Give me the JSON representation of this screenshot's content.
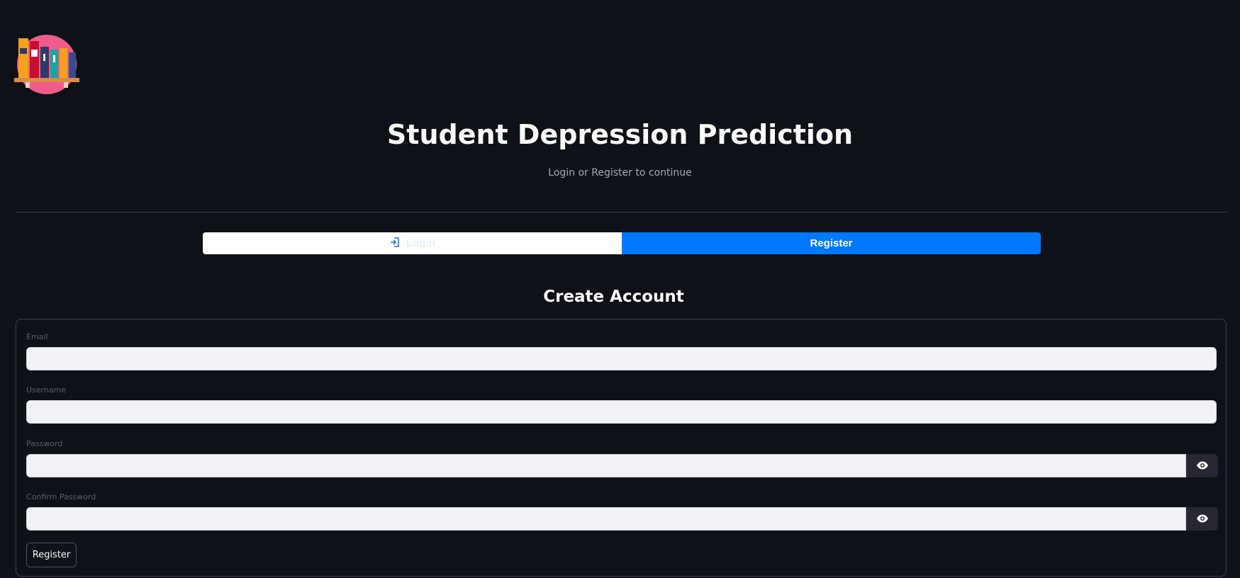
{
  "app": {
    "title": "Student Depression Prediction",
    "subtitle": "Login or Register to continue"
  },
  "tabs": [
    {
      "label": "Login",
      "icon": "login-icon",
      "active": false
    },
    {
      "label": "Register",
      "active": true
    }
  ],
  "form": {
    "heading": "Create Account",
    "fields": {
      "email": {
        "label": "Email",
        "value": ""
      },
      "username": {
        "label": "Username",
        "value": ""
      },
      "password": {
        "label": "Password",
        "value": "",
        "toggle_icon": "eye-icon"
      },
      "confirm_password": {
        "label": "Confirm Password",
        "value": "",
        "toggle_icon": "eye-icon"
      }
    },
    "submit_label": "Register"
  },
  "colors": {
    "background": "#0e1117",
    "accent": "#0078ff",
    "input_bg": "#f0f2f6"
  }
}
